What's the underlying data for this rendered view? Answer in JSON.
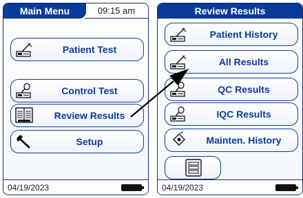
{
  "left_screen": {
    "title": "Main Menu",
    "time": "09:15 am",
    "buttons": [
      {
        "label": "Patient Test",
        "icon": "test-strip-icon"
      },
      {
        "label": "Control Test",
        "icon": "control-bottle-icon"
      },
      {
        "label": "Review Results",
        "icon": "review-book-icon"
      },
      {
        "label": "Setup",
        "icon": "wrench-icon"
      }
    ],
    "date": "04/19/2023",
    "battery_level": 1.0
  },
  "right_screen": {
    "title": "Review Results",
    "buttons": [
      {
        "label": "Patient History",
        "icon": "test-strip-icon"
      },
      {
        "label": "All Results",
        "icon": "test-strip-icon"
      },
      {
        "label": "QC Results",
        "icon": "control-bottle-icon"
      },
      {
        "label": "IQC Results",
        "icon": "control-bottle-icon"
      },
      {
        "label": "Mainten. History",
        "icon": "maintenance-icon"
      }
    ],
    "list_button_icon": "list-icon",
    "date": "04/19/2023",
    "battery_level": 1.0
  },
  "annotation": {
    "icon": "pointer-arrow-icon"
  }
}
